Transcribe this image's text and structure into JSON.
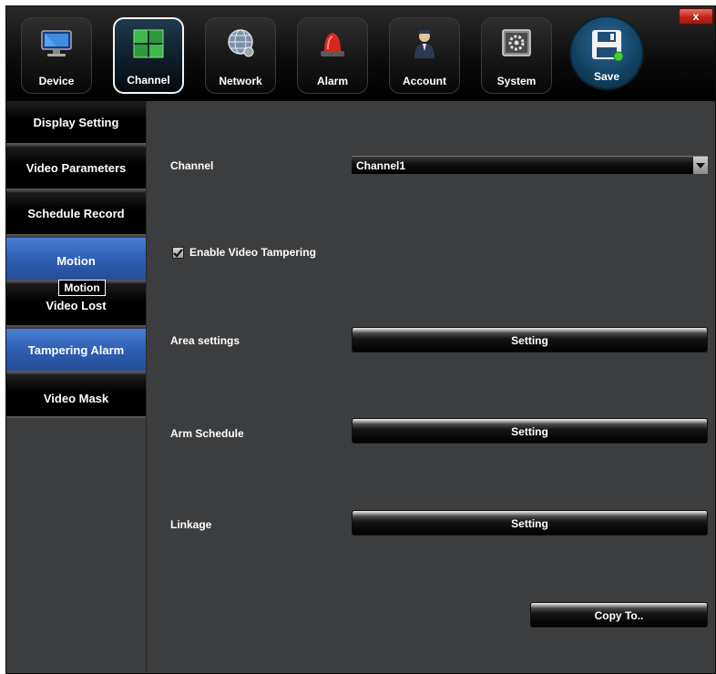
{
  "toolbar": {
    "tabs": [
      {
        "label": "Device",
        "icon": "monitor-icon"
      },
      {
        "label": "Channel",
        "icon": "channel-grid-icon"
      },
      {
        "label": "Network",
        "icon": "network-globe-icon"
      },
      {
        "label": "Alarm",
        "icon": "alarm-siren-icon"
      },
      {
        "label": "Account",
        "icon": "account-user-icon"
      },
      {
        "label": "System",
        "icon": "system-settings-icon"
      }
    ],
    "active_tab": "Channel",
    "save_label": "Save",
    "save_icon": "floppy-disk-icon",
    "close_symbol": "x"
  },
  "sidebar": {
    "items": [
      {
        "label": "Display Setting"
      },
      {
        "label": "Video Parameters"
      },
      {
        "label": "Schedule Record"
      },
      {
        "label": "Motion"
      },
      {
        "label": "Video Lost"
      },
      {
        "label": "Tampering Alarm"
      },
      {
        "label": "Video Mask"
      }
    ],
    "selected": "Tampering Alarm",
    "tooltip": "Motion"
  },
  "content": {
    "channel_label": "Channel",
    "channel_value": "Channel1",
    "enable_label": "Enable Video Tampering",
    "enable_checked": true,
    "area_label": "Area settings",
    "area_button": "Setting",
    "arm_label": "Arm Schedule",
    "arm_button": "Setting",
    "linkage_label": "Linkage",
    "linkage_button": "Setting",
    "copy_button": "Copy To.."
  },
  "colors": {
    "background": "#3c3d3f",
    "highlight_blue": "#2e5fb3",
    "close_red": "#c0261a",
    "channel_green": "#3fb84a"
  }
}
